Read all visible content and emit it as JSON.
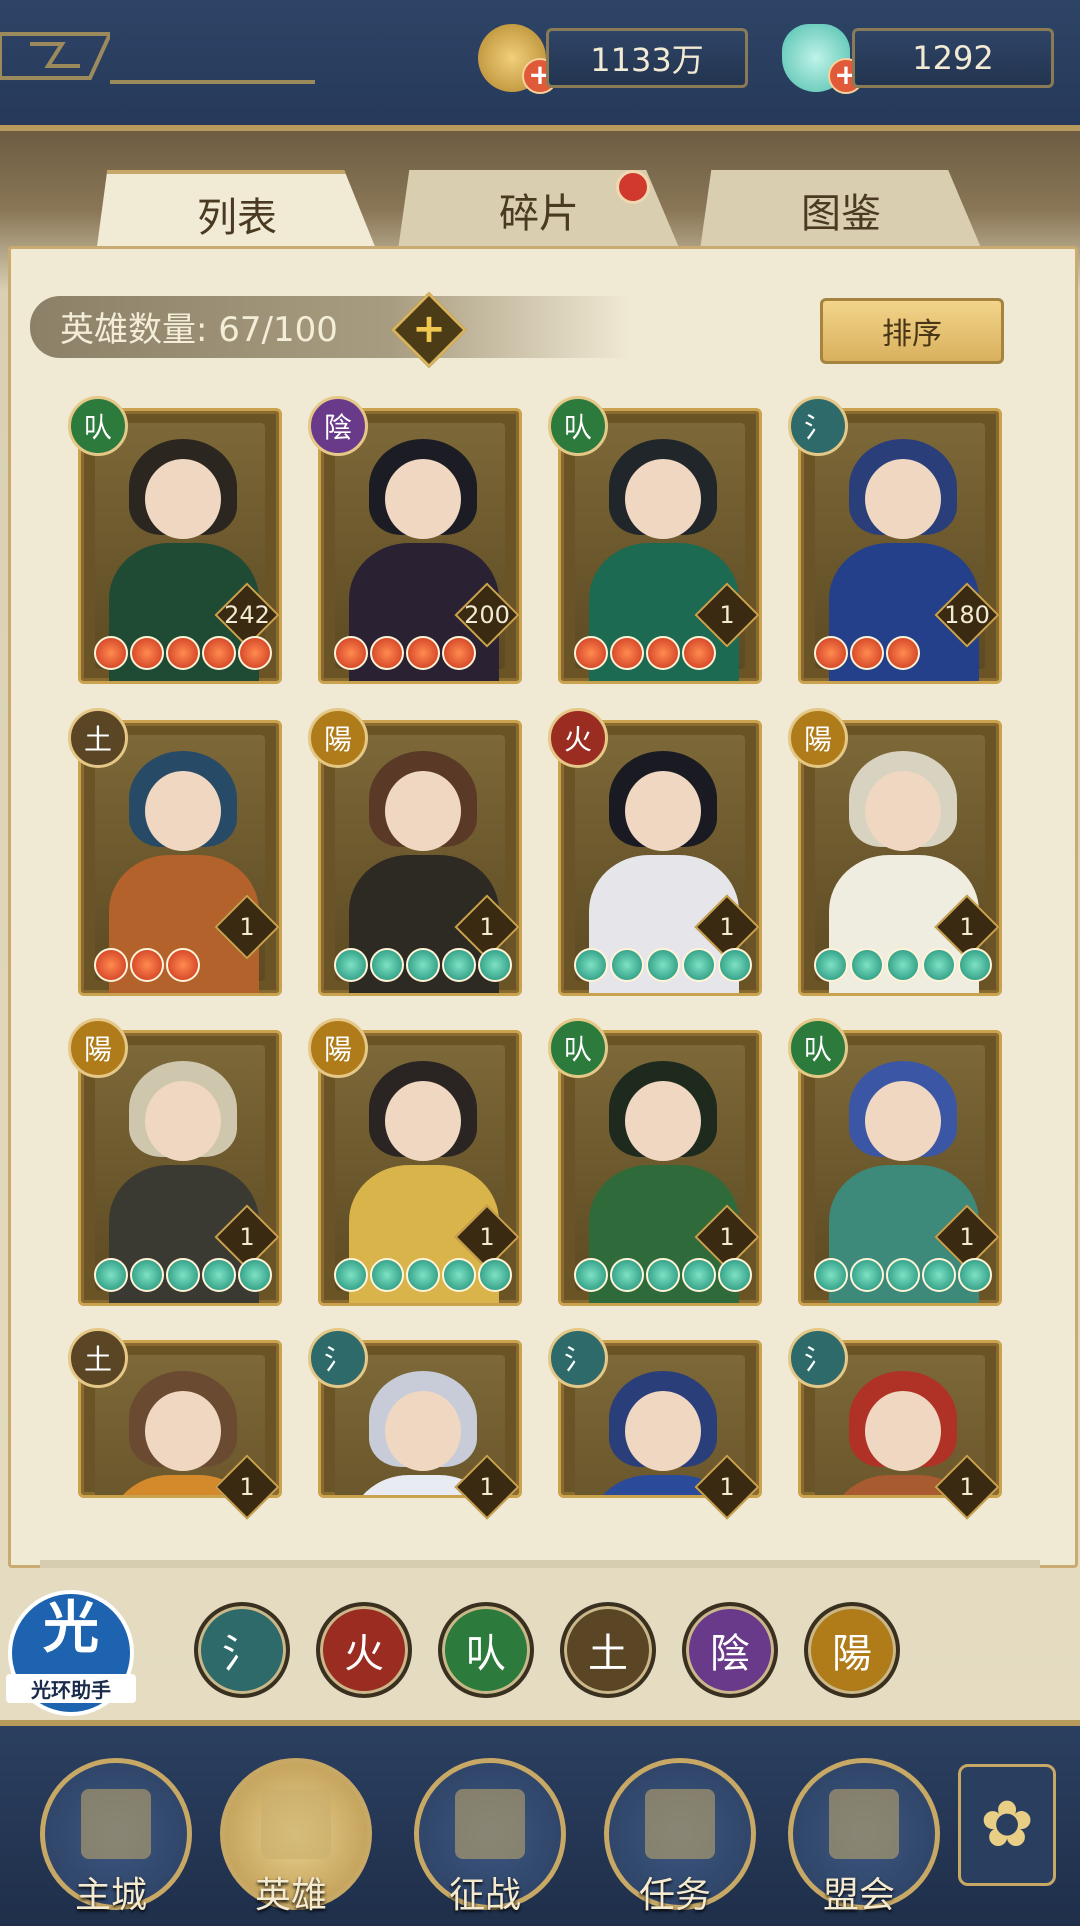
{
  "resources": {
    "coins": "1133万",
    "gems": "1292"
  },
  "tabs": [
    {
      "label": "列表",
      "active": true
    },
    {
      "label": "碎片",
      "active": false,
      "has_notification": true
    },
    {
      "label": "图鉴",
      "active": false
    }
  ],
  "hero_count": "英雄数量: 67/100",
  "sort_label": "排序",
  "heroes": [
    {
      "element": "木",
      "element_glyph": "㕥",
      "level": "242",
      "stars": 5,
      "star_color": "red"
    },
    {
      "element": "阴",
      "element_glyph": "陰",
      "level": "200",
      "stars": 4,
      "star_color": "red"
    },
    {
      "element": "木",
      "element_glyph": "㕥",
      "level": "1",
      "stars": 4,
      "star_color": "red"
    },
    {
      "element": "水",
      "element_glyph": "氵",
      "level": "180",
      "stars": 3,
      "star_color": "red"
    },
    {
      "element": "土",
      "element_glyph": "土",
      "level": "1",
      "stars": 3,
      "star_color": "red"
    },
    {
      "element": "阳",
      "element_glyph": "陽",
      "level": "1",
      "stars": 5,
      "star_color": "teal"
    },
    {
      "element": "火",
      "element_glyph": "火",
      "level": "1",
      "stars": 5,
      "star_color": "teal"
    },
    {
      "element": "阳",
      "element_glyph": "陽",
      "level": "1",
      "stars": 5,
      "star_color": "teal"
    },
    {
      "element": "阳",
      "element_glyph": "陽",
      "level": "1",
      "stars": 5,
      "star_color": "teal"
    },
    {
      "element": "阳",
      "element_glyph": "陽",
      "level": "1",
      "stars": 5,
      "star_color": "teal"
    },
    {
      "element": "木",
      "element_glyph": "㕥",
      "level": "1",
      "stars": 5,
      "star_color": "teal"
    },
    {
      "element": "木",
      "element_glyph": "㕥",
      "level": "1",
      "stars": 5,
      "star_color": "teal"
    },
    {
      "element": "土",
      "element_glyph": "土",
      "level": "1",
      "stars": 0,
      "star_color": "teal"
    },
    {
      "element": "水",
      "element_glyph": "氵",
      "level": "1",
      "stars": 0,
      "star_color": "teal"
    },
    {
      "element": "水",
      "element_glyph": "氵",
      "level": "1",
      "stars": 0,
      "star_color": "teal"
    },
    {
      "element": "水",
      "element_glyph": "氵",
      "level": "1",
      "stars": 0,
      "star_color": "teal"
    }
  ],
  "element_filters": [
    {
      "name": "water",
      "glyph": "氵",
      "color": "#2f6a6a"
    },
    {
      "name": "fire",
      "glyph": "火",
      "color": "#9a2c22"
    },
    {
      "name": "wood",
      "glyph": "㕥",
      "color": "#2c7a3c"
    },
    {
      "name": "earth",
      "glyph": "土",
      "color": "#5a4524"
    },
    {
      "name": "yin",
      "glyph": "陰",
      "color": "#6a3a8a"
    },
    {
      "name": "yang",
      "glyph": "陽",
      "color": "#b07c1a"
    }
  ],
  "element_colors": {
    "木": "#2c7a3c",
    "阴": "#6a3a8a",
    "水": "#2f6a6a",
    "土": "#5a4524",
    "阳": "#b07c1a",
    "火": "#9a2c22"
  },
  "helper": {
    "glyph": "光",
    "label": "光环助手"
  },
  "bottom_nav": [
    {
      "label": "主城",
      "active": false
    },
    {
      "label": "英雄",
      "active": true
    },
    {
      "label": "征战",
      "active": false
    },
    {
      "label": "任务",
      "active": false
    },
    {
      "label": "盟会",
      "active": false
    }
  ]
}
